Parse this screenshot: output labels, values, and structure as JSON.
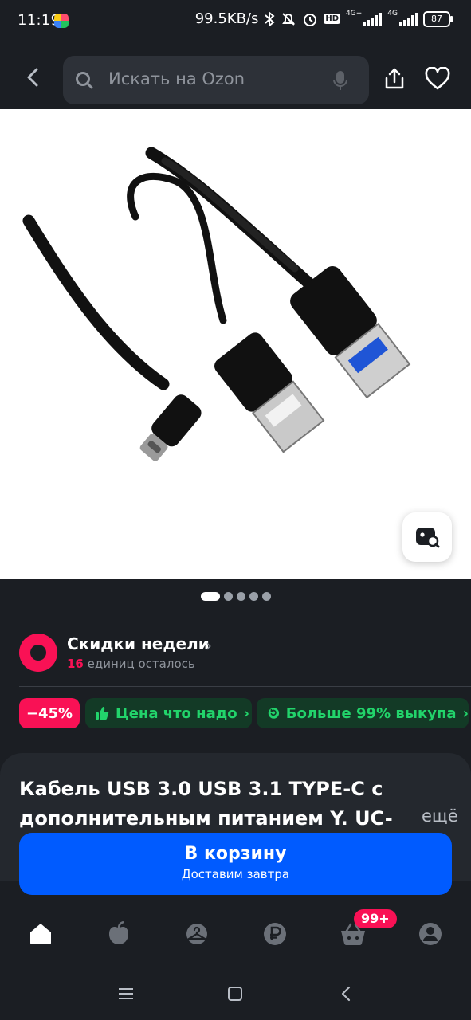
{
  "status_bar": {
    "time": "11:19",
    "speed": "99.5KB/s",
    "net1": "4G+",
    "net2": "4G",
    "battery": "87",
    "hd": "HD"
  },
  "search": {
    "placeholder": "Искать на Ozon"
  },
  "gallery": {
    "image_count": 5,
    "active_index": 0
  },
  "deals": {
    "title": "Скидки недели",
    "count": "16",
    "remaining_text": " единиц осталось"
  },
  "badges": {
    "discount": "−45%",
    "price": "Цена что надо",
    "buyout": "Больше 99% выкупа"
  },
  "product": {
    "title_line1": "Кабель USB 3.0 USB 3.1 TYPE-C с",
    "title_line2": "дополнительным питанием Y. UC-",
    "more": "ещё"
  },
  "cart_button": {
    "label": "В корзину",
    "sublabel": "Доставим завтра"
  },
  "bottom_nav": {
    "cart_badge": "99+"
  },
  "colors": {
    "background": "#1b1e23",
    "accent_blue": "#005bff",
    "accent_pink": "#f91155",
    "accent_green": "#22d46b"
  }
}
